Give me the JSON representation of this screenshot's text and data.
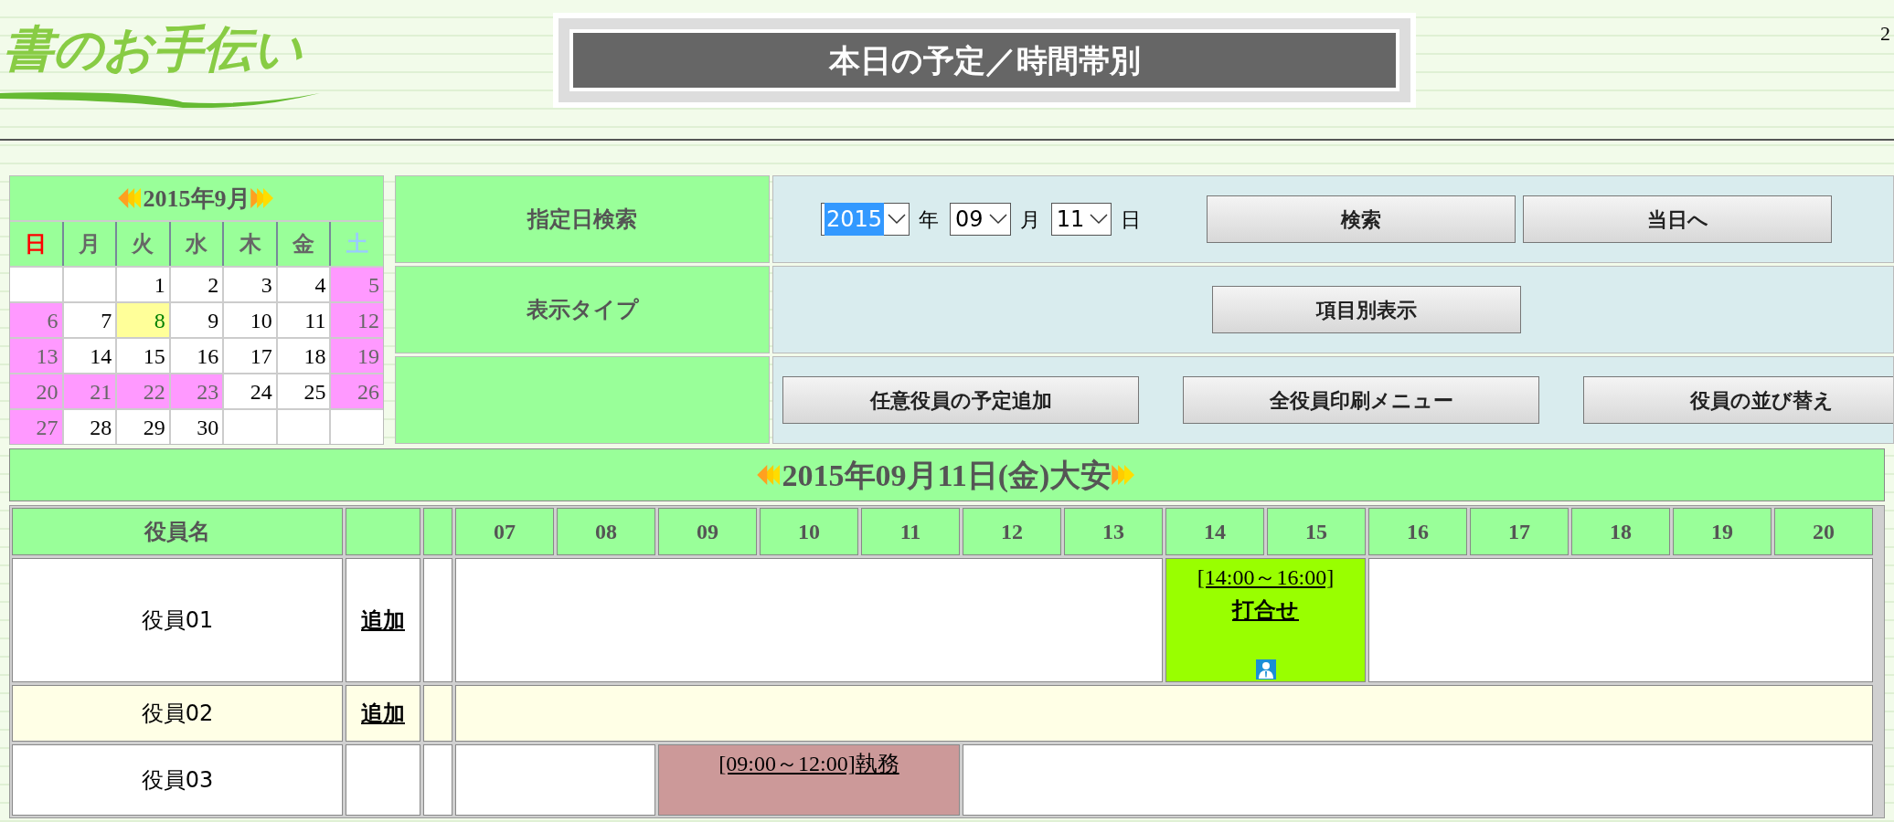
{
  "header": {
    "logo": "書のお手伝い",
    "title": "本日の予定／時間帯別",
    "corner_text": "2"
  },
  "calendar": {
    "month": "2015年9月",
    "weekdays": [
      {
        "label": "日",
        "color": "#ff0000"
      },
      {
        "label": "月",
        "color": "#666666"
      },
      {
        "label": "火",
        "color": "#666666"
      },
      {
        "label": "水",
        "color": "#666666"
      },
      {
        "label": "木",
        "color": "#666666"
      },
      {
        "label": "金",
        "color": "#666666"
      },
      {
        "label": "土",
        "color": "#99ccff"
      }
    ],
    "weeks": [
      [
        {
          "day": "1",
          "kind": "plain"
        },
        {
          "day": "2",
          "kind": "plain"
        },
        {
          "day": "3",
          "kind": "plain"
        },
        {
          "day": "4",
          "kind": "plain"
        },
        {
          "day": "5",
          "kind": "holiday"
        }
      ],
      [
        {
          "day": "6",
          "kind": "holiday"
        },
        {
          "day": "7",
          "kind": "plain"
        },
        {
          "day": "8",
          "kind": "marked"
        },
        {
          "day": "9",
          "kind": "plain"
        },
        {
          "day": "10",
          "kind": "plain"
        },
        {
          "day": "11",
          "kind": "plain"
        },
        {
          "day": "12",
          "kind": "holiday"
        }
      ],
      [
        {
          "day": "13",
          "kind": "holiday"
        },
        {
          "day": "14",
          "kind": "plain"
        },
        {
          "day": "15",
          "kind": "plain"
        },
        {
          "day": "16",
          "kind": "plain"
        },
        {
          "day": "17",
          "kind": "plain"
        },
        {
          "day": "18",
          "kind": "plain"
        },
        {
          "day": "19",
          "kind": "holiday"
        }
      ],
      [
        {
          "day": "20",
          "kind": "holiday"
        },
        {
          "day": "21",
          "kind": "holiday"
        },
        {
          "day": "22",
          "kind": "holiday"
        },
        {
          "day": "23",
          "kind": "holiday"
        },
        {
          "day": "24",
          "kind": "plain"
        },
        {
          "day": "25",
          "kind": "plain"
        },
        {
          "day": "26",
          "kind": "holiday"
        }
      ],
      [
        {
          "day": "27",
          "kind": "holiday"
        },
        {
          "day": "28",
          "kind": "plain"
        },
        {
          "day": "29",
          "kind": "plain"
        },
        {
          "day": "30",
          "kind": "plain"
        }
      ]
    ]
  },
  "controls": {
    "rows": [
      {
        "label": "指定日検索",
        "kind": "date",
        "selects": [
          {
            "value": "2015",
            "unit": "年",
            "focused": true
          },
          {
            "value": "09",
            "unit": "月",
            "focused": false
          },
          {
            "value": "11",
            "unit": "日",
            "focused": false
          }
        ],
        "buttons": [
          "検索",
          "当日へ"
        ]
      },
      {
        "label": "表示タイプ",
        "kind": "center",
        "buttons": [
          "項目別表示"
        ]
      },
      {
        "kind": "spread",
        "buttons": [
          "任意役員の予定追加",
          "全役員印刷メニュー",
          "役員の並び替え"
        ]
      }
    ]
  },
  "date_banner": "2015年09月11日(金)大安",
  "schedule": {
    "name_header": "役員名",
    "hours": [
      "07",
      "08",
      "09",
      "10",
      "11",
      "12",
      "13",
      "14",
      "15",
      "16",
      "17",
      "18",
      "19",
      "20"
    ],
    "rows": [
      {
        "name": "役員01",
        "add_link": "追加",
        "shaded": false,
        "slots": [
          {
            "kind": "free"
          },
          {
            "kind": "free"
          },
          {
            "kind": "free"
          },
          {
            "kind": "free"
          },
          {
            "kind": "free"
          },
          {
            "kind": "free"
          },
          {
            "kind": "free"
          },
          {
            "kind": "event",
            "time": "[14:00～16:00]",
            "title": "打合せ",
            "icon": true,
            "color": "#99ff00"
          },
          {
            "kind": "continued"
          },
          {
            "kind": "free"
          },
          {
            "kind": "free"
          },
          {
            "kind": "free"
          },
          {
            "kind": "free"
          },
          {
            "kind": "free"
          }
        ]
      },
      {
        "name": "役員02",
        "add_link": "追加",
        "shaded": true,
        "slots": [
          {
            "kind": "free"
          },
          {
            "kind": "free"
          },
          {
            "kind": "free"
          },
          {
            "kind": "free"
          },
          {
            "kind": "free"
          },
          {
            "kind": "free"
          },
          {
            "kind": "free"
          },
          {
            "kind": "free"
          },
          {
            "kind": "free"
          },
          {
            "kind": "free"
          },
          {
            "kind": "free"
          },
          {
            "kind": "free"
          },
          {
            "kind": "free"
          },
          {
            "kind": "free"
          }
        ]
      },
      {
        "name": "役員03",
        "shaded": false,
        "slots": [
          {
            "kind": "free"
          },
          {
            "kind": "free"
          },
          {
            "kind": "event",
            "time": "[09:00～12:00]",
            "title": "執務",
            "icon": false,
            "color": "#cc9999"
          },
          {
            "kind": "continued"
          },
          {
            "kind": "continued"
          },
          {
            "kind": "free"
          },
          {
            "kind": "free"
          },
          {
            "kind": "free"
          },
          {
            "kind": "free"
          },
          {
            "kind": "free"
          },
          {
            "kind": "free"
          },
          {
            "kind": "free"
          },
          {
            "kind": "free"
          },
          {
            "kind": "free"
          }
        ]
      }
    ]
  }
}
